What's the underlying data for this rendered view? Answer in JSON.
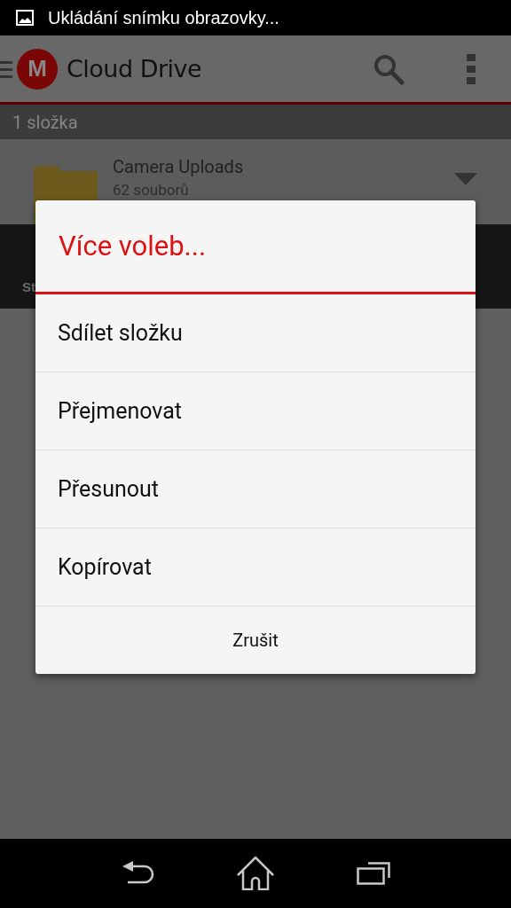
{
  "status_bar": {
    "notification": "Ukládání snímku obrazovky..."
  },
  "app_bar": {
    "logo": "M",
    "title": "Cloud Drive"
  },
  "section_header": "1 složka",
  "folders": [
    {
      "name": "Camera Uploads",
      "info": "62 souborů"
    }
  ],
  "bottom_bar": {
    "text": "St"
  },
  "dialog": {
    "title": "Více voleb...",
    "options": [
      "Sdílet složku",
      "Přejmenovat",
      "Přesunout",
      "Kopírovat"
    ],
    "cancel": "Zrušit"
  }
}
